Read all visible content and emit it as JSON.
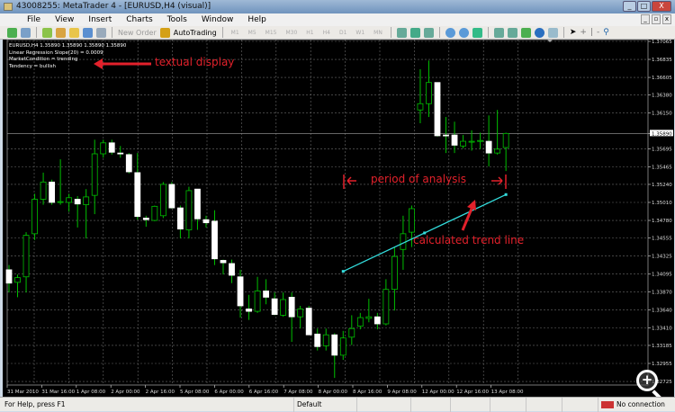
{
  "window": {
    "title": "43008255: MetaTrader 4 - [EURUSD,H4 (visual)]",
    "controls": [
      "_",
      "□",
      "X"
    ]
  },
  "menu": [
    "File",
    "View",
    "Insert",
    "Charts",
    "Tools",
    "Window",
    "Help"
  ],
  "toolbar": {
    "new_order": "New Order",
    "autotrading": "AutoTrading",
    "timeframes": [
      "M1",
      "M5",
      "M15",
      "M30",
      "H1",
      "H4",
      "D1",
      "W1",
      "MN"
    ]
  },
  "info": {
    "line1": "EURUSD,H4 1.35890 1.35890 1.35890 1.35890",
    "line2": "Linear Regression Slope(20) = 0.0009",
    "line3": "MarketCondition = trending",
    "line4": "Tendency = bullish"
  },
  "annotations": {
    "textual": "textual display",
    "period": "period of analysis",
    "trend": "calculated trend line",
    "color": "#e3212b"
  },
  "chart_data": {
    "type": "candlestick",
    "symbol": "EURUSD",
    "timeframe": "H4",
    "current_price": 1.3589,
    "price_ticks": [
      "1.37065",
      "1.36835",
      "1.36605",
      "1.36380",
      "1.36150",
      "1.35890",
      "1.35695",
      "1.35465",
      "1.35240",
      "1.35010",
      "1.34780",
      "1.34555",
      "1.34325",
      "1.34095",
      "1.33870",
      "1.33640",
      "1.33410",
      "1.33185",
      "1.32955",
      "1.32725"
    ],
    "time_ticks": [
      "31 Mar 2010",
      "31 Mar 16:00",
      "1 Apr 08:00",
      "2 Apr 00:00",
      "2 Apr 16:00",
      "5 Apr 08:00",
      "6 Apr 00:00",
      "6 Apr 16:00",
      "7 Apr 08:00",
      "8 Apr 00:00",
      "8 Apr 16:00",
      "9 Apr 08:00",
      "12 Apr 00:00",
      "12 Apr 16:00",
      "13 Apr 08:00"
    ],
    "ohlc": [
      [
        1.3415,
        1.3421,
        1.3386,
        1.3398
      ],
      [
        1.3399,
        1.3409,
        1.338,
        1.3405
      ],
      [
        1.3406,
        1.3463,
        1.3386,
        1.3459
      ],
      [
        1.3461,
        1.3512,
        1.3453,
        1.3505
      ],
      [
        1.3505,
        1.3539,
        1.3498,
        1.3527
      ],
      [
        1.3527,
        1.353,
        1.3498,
        1.3501
      ],
      [
        1.3501,
        1.3556,
        1.3498,
        1.3502
      ],
      [
        1.3501,
        1.3512,
        1.3489,
        1.3507
      ],
      [
        1.3505,
        1.3509,
        1.3469,
        1.3499
      ],
      [
        1.3498,
        1.3518,
        1.3455,
        1.3508
      ],
      [
        1.351,
        1.3581,
        1.3486,
        1.3563
      ],
      [
        1.3563,
        1.3581,
        1.3558,
        1.3577
      ],
      [
        1.3577,
        1.3581,
        1.3562,
        1.3565
      ],
      [
        1.3564,
        1.3573,
        1.3558,
        1.3563
      ],
      [
        1.3562,
        1.3564,
        1.3538,
        1.354
      ],
      [
        1.3539,
        1.3564,
        1.3479,
        1.3483
      ],
      [
        1.3481,
        1.3484,
        1.347,
        1.3479
      ],
      [
        1.3478,
        1.3497,
        1.3477,
        1.3496
      ],
      [
        1.3484,
        1.3527,
        1.3481,
        1.3524
      ],
      [
        1.3524,
        1.3527,
        1.3493,
        1.3494
      ],
      [
        1.3494,
        1.3497,
        1.3455,
        1.3467
      ],
      [
        1.3466,
        1.3521,
        1.3455,
        1.3516
      ],
      [
        1.3518,
        1.3518,
        1.3466,
        1.348
      ],
      [
        1.3479,
        1.3484,
        1.3469,
        1.3475
      ],
      [
        1.3477,
        1.3491,
        1.3421,
        1.3429
      ],
      [
        1.3427,
        1.3428,
        1.3409,
        1.3424
      ],
      [
        1.3423,
        1.3428,
        1.3398,
        1.3408
      ],
      [
        1.3406,
        1.3415,
        1.3354,
        1.3369
      ],
      [
        1.3365,
        1.3383,
        1.3351,
        1.3362
      ],
      [
        1.3362,
        1.3406,
        1.336,
        1.3388
      ],
      [
        1.3388,
        1.3403,
        1.3371,
        1.338
      ],
      [
        1.3378,
        1.3386,
        1.3357,
        1.3358
      ],
      [
        1.3357,
        1.3386,
        1.3355,
        1.3377
      ],
      [
        1.338,
        1.3386,
        1.3323,
        1.3355
      ],
      [
        1.3355,
        1.3369,
        1.334,
        1.3365
      ],
      [
        1.3366,
        1.3369,
        1.3332,
        1.3332
      ],
      [
        1.3333,
        1.334,
        1.3312,
        1.3317
      ],
      [
        1.3318,
        1.334,
        1.3312,
        1.3332
      ],
      [
        1.3332,
        1.3334,
        1.3277,
        1.3306
      ],
      [
        1.3306,
        1.3337,
        1.33,
        1.3328
      ],
      [
        1.3329,
        1.3357,
        1.3319,
        1.334
      ],
      [
        1.3343,
        1.336,
        1.3339,
        1.3354
      ],
      [
        1.3353,
        1.3378,
        1.3348,
        1.3355
      ],
      [
        1.3355,
        1.336,
        1.3339,
        1.3346
      ],
      [
        1.3346,
        1.3403,
        1.3344,
        1.339
      ],
      [
        1.339,
        1.3444,
        1.3363,
        1.3432
      ],
      [
        1.3441,
        1.3484,
        1.3415,
        1.3461
      ],
      [
        1.3463,
        1.3497,
        1.3444,
        1.3493
      ],
      [
        1.3619,
        1.3671,
        1.3602,
        1.3627
      ],
      [
        1.3627,
        1.3682,
        1.361,
        1.3654
      ],
      [
        1.3654,
        1.3654,
        1.3585,
        1.3586
      ],
      [
        1.3587,
        1.361,
        1.3564,
        1.3586
      ],
      [
        1.3587,
        1.3604,
        1.3564,
        1.3574
      ],
      [
        1.3573,
        1.3587,
        1.357,
        1.3579
      ],
      [
        1.3578,
        1.3593,
        1.3567,
        1.3579
      ],
      [
        1.3579,
        1.359,
        1.3569,
        1.358
      ],
      [
        1.3579,
        1.3612,
        1.3547,
        1.3564
      ],
      [
        1.3564,
        1.3619,
        1.3562,
        1.3569
      ],
      [
        1.3571,
        1.359,
        1.3541,
        1.3589
      ]
    ],
    "trend_line": {
      "from_bar": 39,
      "to_bar": 58,
      "from_price": 1.3413,
      "to_price": 1.3511
    },
    "colors": {
      "bull": "#00c000",
      "bear_body": "#ffffff",
      "grid": "#6b6b6b",
      "trend": "#33dddd",
      "bg": "#000000"
    }
  },
  "status": {
    "help": "For Help, press F1",
    "profile": "Default",
    "connection": "No connection"
  }
}
